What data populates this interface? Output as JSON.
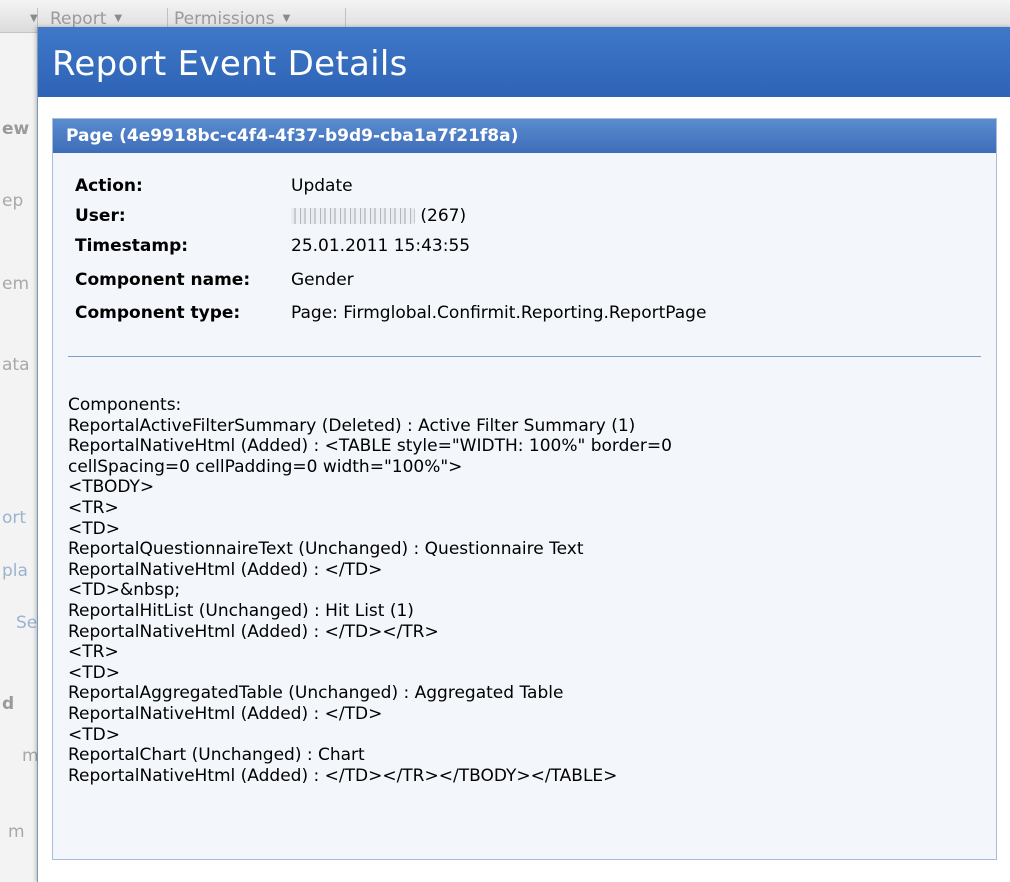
{
  "background": {
    "tabs": [
      {
        "label": "Report"
      },
      {
        "label": "Permissions"
      }
    ],
    "sidebar_fragments": [
      {
        "text": "ew"
      },
      {
        "text": "ep"
      },
      {
        "text": "em"
      },
      {
        "text": "ata"
      },
      {
        "text": "ort"
      },
      {
        "text": "pla"
      },
      {
        "text": "Se"
      },
      {
        "text": "d"
      },
      {
        "text": "m"
      },
      {
        "text": "m"
      }
    ]
  },
  "dialog": {
    "title": "Report Event Details",
    "panel_title": "Page (4e9918bc-c4f4-4f37-b9d9-cba1a7f21f8a)",
    "fields": [
      {
        "label": "Action:",
        "value": "Update"
      },
      {
        "label": "User:",
        "value": "(267)",
        "redacted": true
      },
      {
        "label": "Timestamp:",
        "value": "25.01.2011 15:43:55"
      },
      {
        "label": "Component name:",
        "value": "Gender"
      },
      {
        "label": "Component type:",
        "value": "Page: Firmglobal.Confirmit.Reporting.ReportPage"
      }
    ],
    "components_lines": [
      "Components:",
      "ReportalActiveFilterSummary (Deleted) : Active Filter Summary (1)",
      "ReportalNativeHtml (Added) : <TABLE style=\"WIDTH: 100%\" border=0",
      "cellSpacing=0 cellPadding=0 width=\"100%\">",
      "<TBODY>",
      "<TR>",
      "<TD>",
      "ReportalQuestionnaireText (Unchanged) : Questionnaire Text",
      "ReportalNativeHtml (Added) : </TD>",
      "<TD>&nbsp;",
      "ReportalHitList (Unchanged) : Hit List (1)",
      "ReportalNativeHtml (Added) : </TD></TR>",
      "<TR>",
      "<TD>",
      "ReportalAggregatedTable (Unchanged) : Aggregated Table",
      "ReportalNativeHtml (Added) : </TD>",
      "<TD>",
      "ReportalChart (Unchanged) : Chart",
      "ReportalNativeHtml (Added) : </TD></TR></TBODY></TABLE>"
    ]
  },
  "colors": {
    "header_blue": "#3f78c9",
    "panel_header_blue": "#4a7cc4",
    "panel_bg": "#f3f6fb",
    "divider": "#7da0cb"
  }
}
